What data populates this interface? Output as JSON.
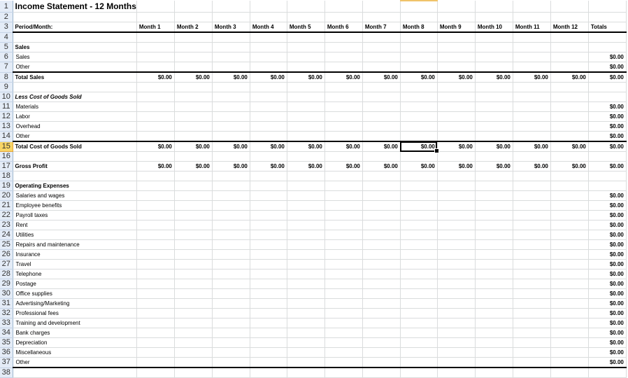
{
  "sheet": {
    "title": "Income Statement - 12 Months",
    "selected_cell": {
      "row": 15,
      "column": "Month 8",
      "value": "$0.00"
    },
    "header_label": "Period/Month:",
    "columns": [
      "Month 1",
      "Month 2",
      "Month 3",
      "Month 4",
      "Month 5",
      "Month 6",
      "Month 7",
      "Month 8",
      "Month 9",
      "Month 10",
      "Month 11",
      "Month 12",
      "Totals"
    ],
    "rows": [
      {
        "n": "1",
        "label": "Income Statement - 12 Months",
        "type": "title"
      },
      {
        "n": "2",
        "label": "",
        "type": "blank"
      },
      {
        "n": "3",
        "label": "Period/Month:",
        "type": "header"
      },
      {
        "n": "4",
        "label": "",
        "type": "blank"
      },
      {
        "n": "5",
        "label": "Sales",
        "type": "section"
      },
      {
        "n": "6",
        "label": "Sales",
        "type": "item",
        "total": "$0.00"
      },
      {
        "n": "7",
        "label": "Other",
        "type": "item",
        "total": "$0.00"
      },
      {
        "n": "8",
        "label": "Total Sales",
        "type": "total",
        "months": [
          "$0.00",
          "$0.00",
          "$0.00",
          "$0.00",
          "$0.00",
          "$0.00",
          "$0.00",
          "$0.00",
          "$0.00",
          "$0.00",
          "$0.00",
          "$0.00"
        ],
        "total": "$0.00"
      },
      {
        "n": "9",
        "label": "",
        "type": "blank"
      },
      {
        "n": "10",
        "label": "Less Cost of Goods Sold",
        "type": "section-italic"
      },
      {
        "n": "11",
        "label": "Materials",
        "type": "item",
        "total": "$0.00"
      },
      {
        "n": "12",
        "label": "Labor",
        "type": "item",
        "total": "$0.00"
      },
      {
        "n": "13",
        "label": "Overhead",
        "type": "item",
        "total": "$0.00"
      },
      {
        "n": "14",
        "label": "Other",
        "type": "item",
        "total": "$0.00"
      },
      {
        "n": "15",
        "label": "Total Cost of Goods Sold",
        "type": "total",
        "months": [
          "$0.00",
          "$0.00",
          "$0.00",
          "$0.00",
          "$0.00",
          "$0.00",
          "$0.00",
          "$0.00",
          "$0.00",
          "$0.00",
          "$0.00",
          "$0.00"
        ],
        "total": "$0.00"
      },
      {
        "n": "16",
        "label": "",
        "type": "blank"
      },
      {
        "n": "17",
        "label": "Gross Profit",
        "type": "total-plain",
        "months": [
          "$0.00",
          "$0.00",
          "$0.00",
          "$0.00",
          "$0.00",
          "$0.00",
          "$0.00",
          "$0.00",
          "$0.00",
          "$0.00",
          "$0.00",
          "$0.00"
        ],
        "total": "$0.00"
      },
      {
        "n": "18",
        "label": "",
        "type": "blank"
      },
      {
        "n": "19",
        "label": "Operating Expenses",
        "type": "section"
      },
      {
        "n": "20",
        "label": "Salaries and wages",
        "type": "item",
        "total": "$0.00"
      },
      {
        "n": "21",
        "label": "Employee benefits",
        "type": "item",
        "total": "$0.00"
      },
      {
        "n": "22",
        "label": "Payroll taxes",
        "type": "item",
        "total": "$0.00"
      },
      {
        "n": "23",
        "label": "Rent",
        "type": "item",
        "total": "$0.00"
      },
      {
        "n": "24",
        "label": "Utilities",
        "type": "item",
        "total": "$0.00"
      },
      {
        "n": "25",
        "label": "Repairs and maintenance",
        "type": "item",
        "total": "$0.00"
      },
      {
        "n": "26",
        "label": "Insurance",
        "type": "item",
        "total": "$0.00"
      },
      {
        "n": "27",
        "label": "Travel",
        "type": "item",
        "total": "$0.00"
      },
      {
        "n": "28",
        "label": "Telephone",
        "type": "item",
        "total": "$0.00"
      },
      {
        "n": "29",
        "label": "Postage",
        "type": "item",
        "total": "$0.00"
      },
      {
        "n": "30",
        "label": "Office supplies",
        "type": "item",
        "total": "$0.00"
      },
      {
        "n": "31",
        "label": "Advertising/Marketing",
        "type": "item",
        "total": "$0.00"
      },
      {
        "n": "32",
        "label": "Professional fees",
        "type": "item",
        "total": "$0.00"
      },
      {
        "n": "33",
        "label": "Training and development",
        "type": "item",
        "total": "$0.00"
      },
      {
        "n": "34",
        "label": "Bank charges",
        "type": "item",
        "total": "$0.00"
      },
      {
        "n": "35",
        "label": "Depreciation",
        "type": "item",
        "total": "$0.00"
      },
      {
        "n": "36",
        "label": "Miscellaneous",
        "type": "item",
        "total": "$0.00"
      },
      {
        "n": "37",
        "label": "Other",
        "type": "item",
        "total": "$0.00"
      },
      {
        "n": "38",
        "label": "",
        "type": "blank"
      }
    ]
  }
}
